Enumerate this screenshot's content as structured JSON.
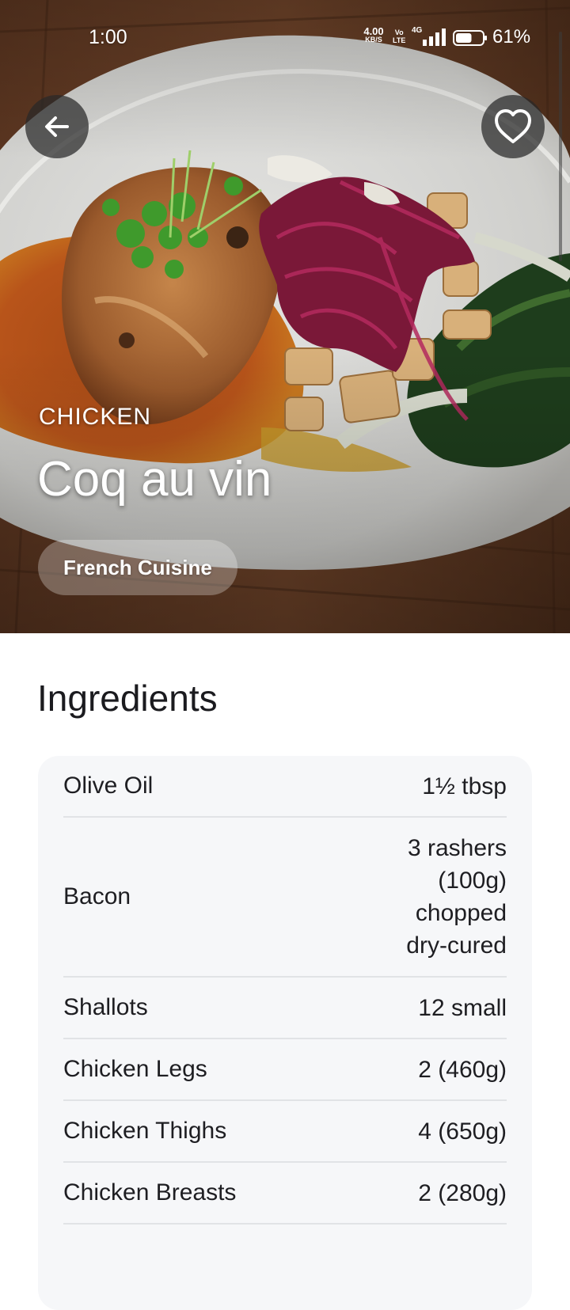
{
  "status_bar": {
    "time": "1:00",
    "network_speed": "4.00",
    "network_unit": "KB/S",
    "volte_top": "Vo",
    "volte_bottom": "LTE",
    "signal_label": "4G",
    "battery_level_percent": 61,
    "battery_percent": "61%"
  },
  "hero": {
    "category": "CHICKEN",
    "title": "Coq au vin",
    "chip": "French Cuisine",
    "back_icon": "arrow-left-icon",
    "favorite_icon": "heart-outline-icon"
  },
  "ingredients": {
    "title": "Ingredients",
    "items": [
      {
        "name": "Olive Oil",
        "qty": "1½ tbsp"
      },
      {
        "name": "Bacon",
        "qty": "3 rashers (100g) chopped dry-cured"
      },
      {
        "name": "Shallots",
        "qty": "12 small"
      },
      {
        "name": "Chicken Legs",
        "qty": "2 (460g)"
      },
      {
        "name": "Chicken Thighs",
        "qty": "4 (650g)"
      },
      {
        "name": "Chicken Breasts",
        "qty": "2 (280g)"
      }
    ]
  }
}
